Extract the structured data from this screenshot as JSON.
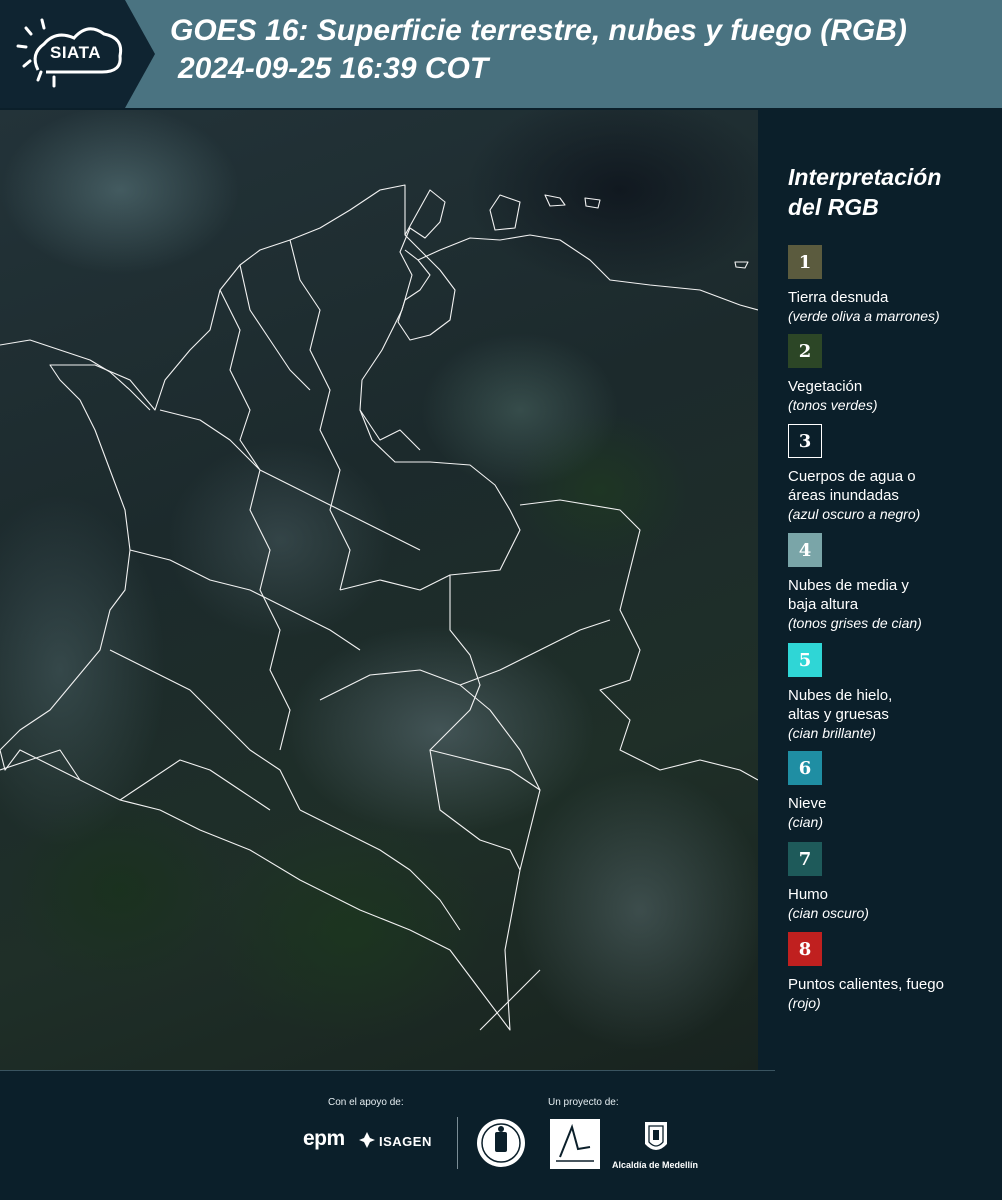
{
  "header": {
    "logo_text": "SIATA",
    "title_line1": "GOES 16: Superficie terrestre, nubes y fuego (RGB)",
    "title_line2": "2024-09-25 16:39 COT",
    "background_color": "#4a7381"
  },
  "legend": {
    "title_line1": "Interpretación",
    "title_line2": "del RGB",
    "items": [
      {
        "number": "1",
        "label": "Tierra desnuda",
        "desc": "(verde oliva a marrones)",
        "color": "#5b5b3e"
      },
      {
        "number": "2",
        "label": "Vegetación",
        "desc": "(tonos verdes)",
        "color": "#2c4626"
      },
      {
        "number": "3",
        "label": "Cuerpos de agua o áreas inundadas",
        "desc": "(azul oscuro a negro)",
        "color": "#0b1f2a"
      },
      {
        "number": "4",
        "label": "Nubes de media y baja altura",
        "desc": "(tonos grises de cian)",
        "color": "#7aa5a8"
      },
      {
        "number": "5",
        "label": "Nubes de hielo, altas y gruesas",
        "desc": "(cian brillante)",
        "color": "#2fd6d6"
      },
      {
        "number": "6",
        "label": "Nieve",
        "desc": "(cian)",
        "color": "#1f8ea3"
      },
      {
        "number": "7",
        "label": "Humo",
        "desc": "(cian oscuro)",
        "color": "#1e5a5a"
      },
      {
        "number": "8",
        "label": "Puntos calientes, fuego",
        "desc": "(rojo)",
        "color": "#c0201f"
      }
    ]
  },
  "footer": {
    "support_label": "Con el apoyo de:",
    "project_label": "Un proyecto de:",
    "epm_text": "epm",
    "isagen_text": "ISAGEN",
    "alcaldia_text": "Alcaldía de Medellín"
  }
}
